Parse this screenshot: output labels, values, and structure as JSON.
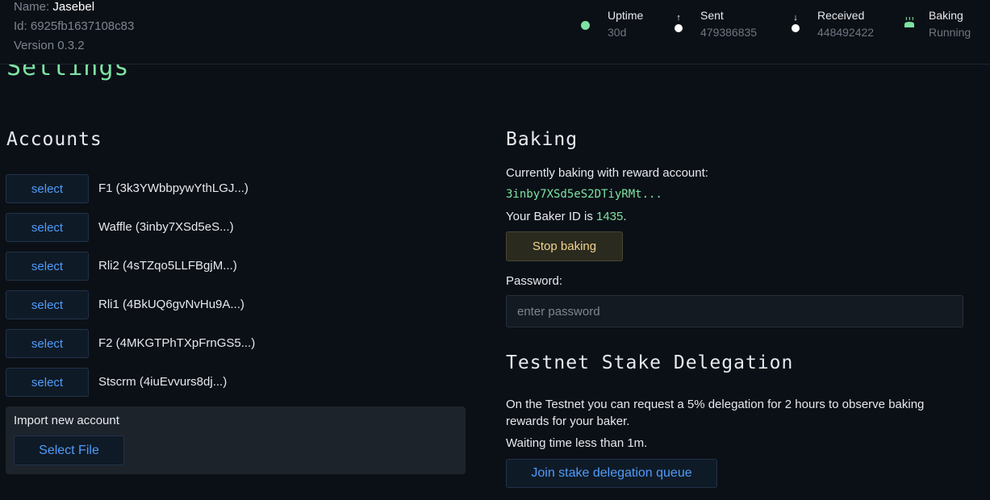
{
  "header": {
    "name_label": "Name:",
    "name_value": "Jasebel",
    "id_label": "Id:",
    "id_value": "6925fb1637108c83",
    "version_label": "Version",
    "version_value": "0.3.2"
  },
  "stats": {
    "uptime": {
      "label": "Uptime",
      "value": "30d",
      "icon": "status-dot-icon",
      "color": "#7ee2a2"
    },
    "sent": {
      "label": "Sent",
      "value": "479386835",
      "icon": "upload-arrow-icon"
    },
    "received": {
      "label": "Received",
      "value": "448492422",
      "icon": "download-arrow-icon"
    },
    "baking": {
      "label": "Baking",
      "value": "Running",
      "icon": "bread-icon",
      "color": "#7ee2a2"
    }
  },
  "page": {
    "title": "Settings"
  },
  "accounts": {
    "heading": "Accounts",
    "select_label": "select",
    "items": [
      {
        "label": "F1 (3k3YWbbpywYthLGJ...)"
      },
      {
        "label": "Waffle (3inby7XSd5eS...)"
      },
      {
        "label": "Rli2 (4sTZqo5LLFBgjM...)"
      },
      {
        "label": "Rli1 (4BkUQ6gvNvHu9A...)"
      },
      {
        "label": "F2 (4MKGTPhTXpFrnGS5...)"
      },
      {
        "label": "Stscrm (4iuEvvurs8dj...)"
      }
    ],
    "import": {
      "label": "Import new account",
      "button": "Select File"
    }
  },
  "baking": {
    "heading": "Baking",
    "reward_text": "Currently baking with reward account:",
    "reward_account": "3inby7XSd5eS2DTiyRMt...",
    "baker_id_prefix": "Your Baker ID is ",
    "baker_id": "1435",
    "baker_id_suffix": ".",
    "stop_button": "Stop baking",
    "password_label": "Password:",
    "password_placeholder": "enter password"
  },
  "delegation": {
    "heading": "Testnet Stake Delegation",
    "description": "On the Testnet you can request a 5% delegation for 2 hours to observe baking rewards for your baker.",
    "waiting": "Waiting time less than 1m.",
    "join_button": "Join stake delegation queue"
  }
}
